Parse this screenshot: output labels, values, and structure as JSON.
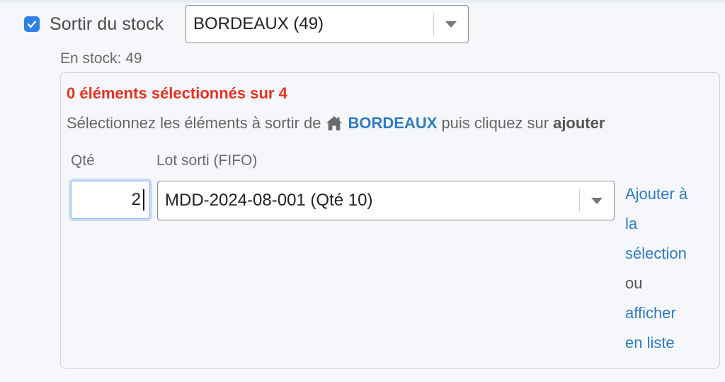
{
  "stock_toggle": {
    "label": "Sortir du stock",
    "checked": true
  },
  "warehouse_select": {
    "value": "BORDEAUX (49)"
  },
  "in_stock": "En stock: 49",
  "panel": {
    "selected_count": "0 éléments sélectionnés sur 4",
    "instructions": {
      "prefix": "Sélectionnez les éléments à sortir de",
      "warehouse": "BORDEAUX",
      "middle": "puis cliquez sur",
      "action": "ajouter"
    },
    "qty_label": "Qté",
    "lot_label": "Lot sorti (FIFO)",
    "qty_value": "2",
    "lot_value": "MDD-2024-08-001 (Qté 10)",
    "actions": {
      "add_line1": "Ajouter à",
      "add_line2": "la",
      "add_line3": "sélection",
      "or": "ou",
      "list_line1": "afficher",
      "list_line2": "en liste"
    }
  },
  "colors": {
    "accent": "#2f7fe6",
    "link": "#2f7cc1",
    "warning": "#e53222"
  },
  "icons": [
    "check-icon",
    "chevron-down-icon",
    "home-icon"
  ]
}
